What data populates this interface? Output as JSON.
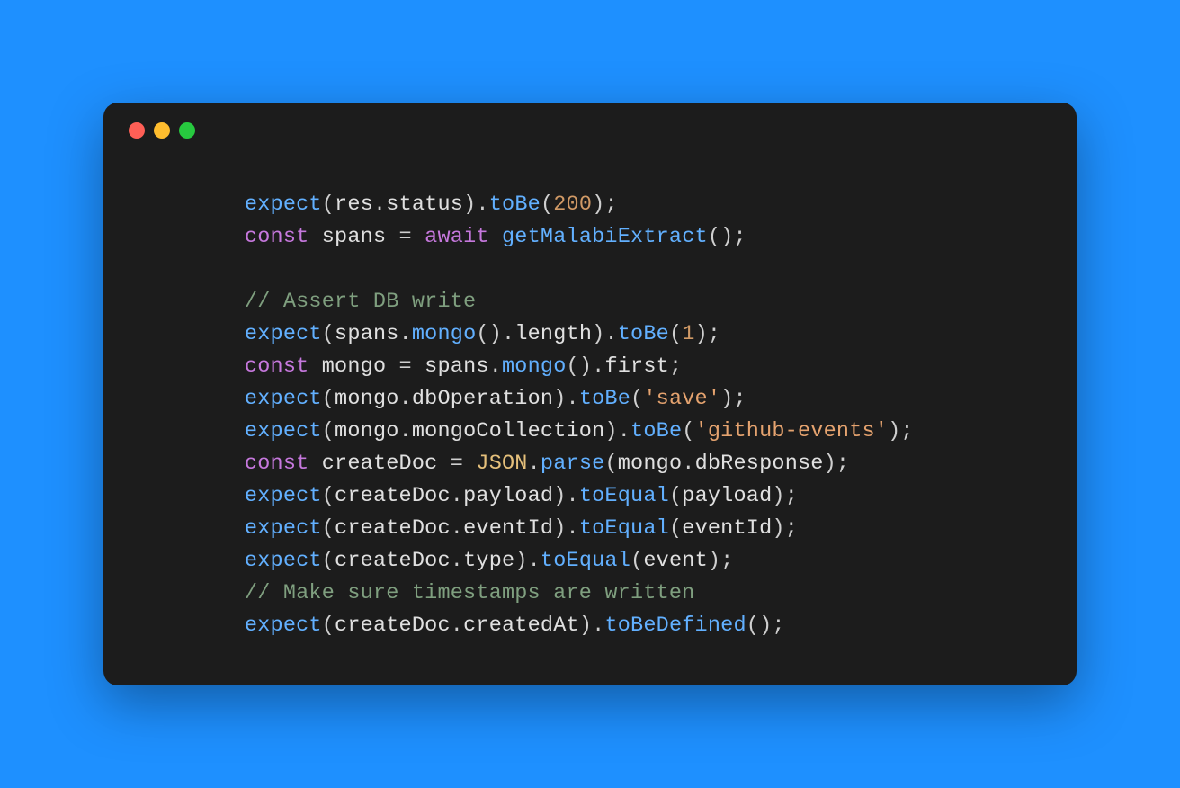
{
  "window": {
    "traffic_lights": [
      "red",
      "yellow",
      "green"
    ]
  },
  "code": {
    "lines": [
      [
        {
          "cls": "tok-fn",
          "t": "expect"
        },
        {
          "cls": "tok-punc",
          "t": "("
        },
        {
          "cls": "tok-ident",
          "t": "res"
        },
        {
          "cls": "tok-punc",
          "t": "."
        },
        {
          "cls": "tok-prop",
          "t": "status"
        },
        {
          "cls": "tok-punc",
          "t": ")."
        },
        {
          "cls": "tok-fn",
          "t": "toBe"
        },
        {
          "cls": "tok-punc",
          "t": "("
        },
        {
          "cls": "tok-num",
          "t": "200"
        },
        {
          "cls": "tok-punc",
          "t": ");"
        }
      ],
      [
        {
          "cls": "tok-kw",
          "t": "const"
        },
        {
          "cls": "tok-punc",
          "t": " "
        },
        {
          "cls": "tok-ident",
          "t": "spans"
        },
        {
          "cls": "tok-punc",
          "t": " = "
        },
        {
          "cls": "tok-kw",
          "t": "await"
        },
        {
          "cls": "tok-punc",
          "t": " "
        },
        {
          "cls": "tok-fn",
          "t": "getMalabiExtract"
        },
        {
          "cls": "tok-punc",
          "t": "();"
        }
      ],
      [
        {
          "cls": "tok-punc",
          "t": ""
        }
      ],
      [
        {
          "cls": "tok-comment",
          "t": "// Assert DB write"
        }
      ],
      [
        {
          "cls": "tok-fn",
          "t": "expect"
        },
        {
          "cls": "tok-punc",
          "t": "("
        },
        {
          "cls": "tok-ident",
          "t": "spans"
        },
        {
          "cls": "tok-punc",
          "t": "."
        },
        {
          "cls": "tok-fn",
          "t": "mongo"
        },
        {
          "cls": "tok-punc",
          "t": "()."
        },
        {
          "cls": "tok-prop",
          "t": "length"
        },
        {
          "cls": "tok-punc",
          "t": ")."
        },
        {
          "cls": "tok-fn",
          "t": "toBe"
        },
        {
          "cls": "tok-punc",
          "t": "("
        },
        {
          "cls": "tok-num",
          "t": "1"
        },
        {
          "cls": "tok-punc",
          "t": ");"
        }
      ],
      [
        {
          "cls": "tok-kw",
          "t": "const"
        },
        {
          "cls": "tok-punc",
          "t": " "
        },
        {
          "cls": "tok-ident",
          "t": "mongo"
        },
        {
          "cls": "tok-punc",
          "t": " = "
        },
        {
          "cls": "tok-ident",
          "t": "spans"
        },
        {
          "cls": "tok-punc",
          "t": "."
        },
        {
          "cls": "tok-fn",
          "t": "mongo"
        },
        {
          "cls": "tok-punc",
          "t": "()."
        },
        {
          "cls": "tok-prop",
          "t": "first"
        },
        {
          "cls": "tok-punc",
          "t": ";"
        }
      ],
      [
        {
          "cls": "tok-fn",
          "t": "expect"
        },
        {
          "cls": "tok-punc",
          "t": "("
        },
        {
          "cls": "tok-ident",
          "t": "mongo"
        },
        {
          "cls": "tok-punc",
          "t": "."
        },
        {
          "cls": "tok-prop",
          "t": "dbOperation"
        },
        {
          "cls": "tok-punc",
          "t": ")."
        },
        {
          "cls": "tok-fn",
          "t": "toBe"
        },
        {
          "cls": "tok-punc",
          "t": "("
        },
        {
          "cls": "tok-str",
          "t": "'save'"
        },
        {
          "cls": "tok-punc",
          "t": ");"
        }
      ],
      [
        {
          "cls": "tok-fn",
          "t": "expect"
        },
        {
          "cls": "tok-punc",
          "t": "("
        },
        {
          "cls": "tok-ident",
          "t": "mongo"
        },
        {
          "cls": "tok-punc",
          "t": "."
        },
        {
          "cls": "tok-prop",
          "t": "mongoCollection"
        },
        {
          "cls": "tok-punc",
          "t": ")."
        },
        {
          "cls": "tok-fn",
          "t": "toBe"
        },
        {
          "cls": "tok-punc",
          "t": "("
        },
        {
          "cls": "tok-str",
          "t": "'github-events'"
        },
        {
          "cls": "tok-punc",
          "t": ");"
        }
      ],
      [
        {
          "cls": "tok-kw",
          "t": "const"
        },
        {
          "cls": "tok-punc",
          "t": " "
        },
        {
          "cls": "tok-ident",
          "t": "createDoc"
        },
        {
          "cls": "tok-punc",
          "t": " = "
        },
        {
          "cls": "tok-obj",
          "t": "JSON"
        },
        {
          "cls": "tok-punc",
          "t": "."
        },
        {
          "cls": "tok-fn",
          "t": "parse"
        },
        {
          "cls": "tok-punc",
          "t": "("
        },
        {
          "cls": "tok-ident",
          "t": "mongo"
        },
        {
          "cls": "tok-punc",
          "t": "."
        },
        {
          "cls": "tok-prop",
          "t": "dbResponse"
        },
        {
          "cls": "tok-punc",
          "t": ");"
        }
      ],
      [
        {
          "cls": "tok-fn",
          "t": "expect"
        },
        {
          "cls": "tok-punc",
          "t": "("
        },
        {
          "cls": "tok-ident",
          "t": "createDoc"
        },
        {
          "cls": "tok-punc",
          "t": "."
        },
        {
          "cls": "tok-prop",
          "t": "payload"
        },
        {
          "cls": "tok-punc",
          "t": ")."
        },
        {
          "cls": "tok-fn",
          "t": "toEqual"
        },
        {
          "cls": "tok-punc",
          "t": "("
        },
        {
          "cls": "tok-ident",
          "t": "payload"
        },
        {
          "cls": "tok-punc",
          "t": ");"
        }
      ],
      [
        {
          "cls": "tok-fn",
          "t": "expect"
        },
        {
          "cls": "tok-punc",
          "t": "("
        },
        {
          "cls": "tok-ident",
          "t": "createDoc"
        },
        {
          "cls": "tok-punc",
          "t": "."
        },
        {
          "cls": "tok-prop",
          "t": "eventId"
        },
        {
          "cls": "tok-punc",
          "t": ")."
        },
        {
          "cls": "tok-fn",
          "t": "toEqual"
        },
        {
          "cls": "tok-punc",
          "t": "("
        },
        {
          "cls": "tok-ident",
          "t": "eventId"
        },
        {
          "cls": "tok-punc",
          "t": ");"
        }
      ],
      [
        {
          "cls": "tok-fn",
          "t": "expect"
        },
        {
          "cls": "tok-punc",
          "t": "("
        },
        {
          "cls": "tok-ident",
          "t": "createDoc"
        },
        {
          "cls": "tok-punc",
          "t": "."
        },
        {
          "cls": "tok-prop",
          "t": "type"
        },
        {
          "cls": "tok-punc",
          "t": ")."
        },
        {
          "cls": "tok-fn",
          "t": "toEqual"
        },
        {
          "cls": "tok-punc",
          "t": "("
        },
        {
          "cls": "tok-ident",
          "t": "event"
        },
        {
          "cls": "tok-punc",
          "t": ");"
        }
      ],
      [
        {
          "cls": "tok-comment",
          "t": "// Make sure timestamps are written"
        }
      ],
      [
        {
          "cls": "tok-fn",
          "t": "expect"
        },
        {
          "cls": "tok-punc",
          "t": "("
        },
        {
          "cls": "tok-ident",
          "t": "createDoc"
        },
        {
          "cls": "tok-punc",
          "t": "."
        },
        {
          "cls": "tok-prop",
          "t": "createdAt"
        },
        {
          "cls": "tok-punc",
          "t": ")."
        },
        {
          "cls": "tok-fn",
          "t": "toBeDefined"
        },
        {
          "cls": "tok-punc",
          "t": "();"
        }
      ]
    ]
  }
}
